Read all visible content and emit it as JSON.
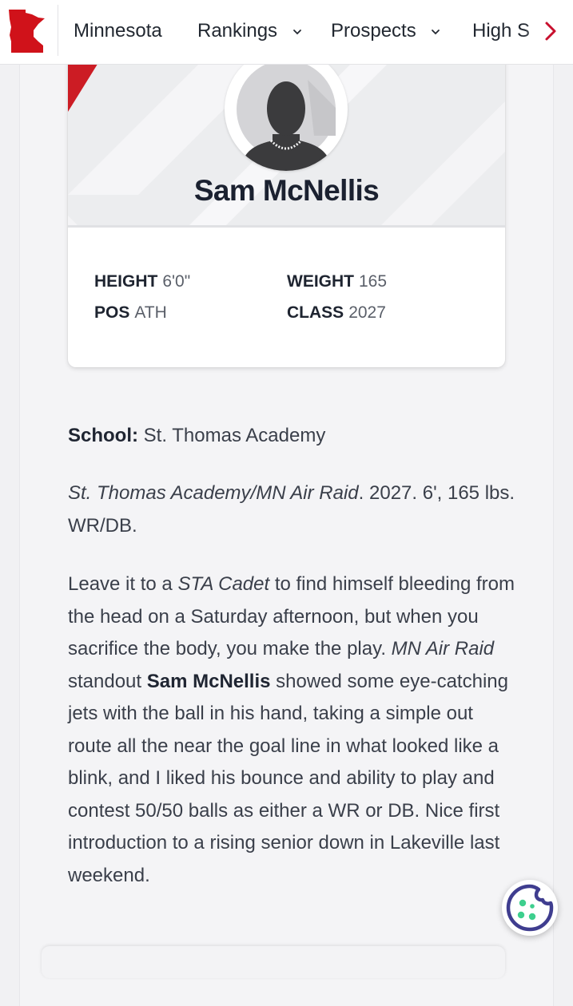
{
  "nav": {
    "logo_alt": "Minnesota state logo",
    "items": [
      {
        "label": "Minnesota",
        "has_dropdown": false
      },
      {
        "label": "Rankings",
        "has_dropdown": true
      },
      {
        "label": "Prospects",
        "has_dropdown": true
      },
      {
        "label": "High S",
        "has_dropdown": false
      }
    ],
    "brand_color": "#d0121a"
  },
  "profile": {
    "name": "Sam McNellis",
    "stats": {
      "height_label": "HEIGHT",
      "height_value": "6'0\"",
      "weight_label": "WEIGHT",
      "weight_value": "165",
      "pos_label": "POS",
      "pos_value": "ATH",
      "class_label": "CLASS",
      "class_value": "2027"
    }
  },
  "article": {
    "school_label": "School:",
    "school_value": "St. Thomas Academy",
    "meta_italic": "St. Thomas Academy/MN Air Raid",
    "meta_rest": ". 2027. 6', 165 lbs. WR/DB.",
    "body": {
      "p1": "Leave it to a ",
      "p2_italic": "STA Cadet",
      "p3": " to find himself bleeding from the head on a Saturday afternoon, but when you sacrifice the body, you make the play. ",
      "p4_italic": "MN Air Raid",
      "p5": " standout ",
      "p6_bold": "Sam McNellis",
      "p7": " showed some eye-catching jets with the ball in his hand, taking a simple out route all the near the goal line in what looked like a blink, and I liked his bounce and ability to play and contest 50/50 balls as either a WR or DB. Nice first introduction to a rising senior down in Lakeville last weekend."
    }
  },
  "cookie": {
    "icon": "cookie-icon",
    "color": "#3f3d8f",
    "chip_color": "#3ecf8e"
  }
}
